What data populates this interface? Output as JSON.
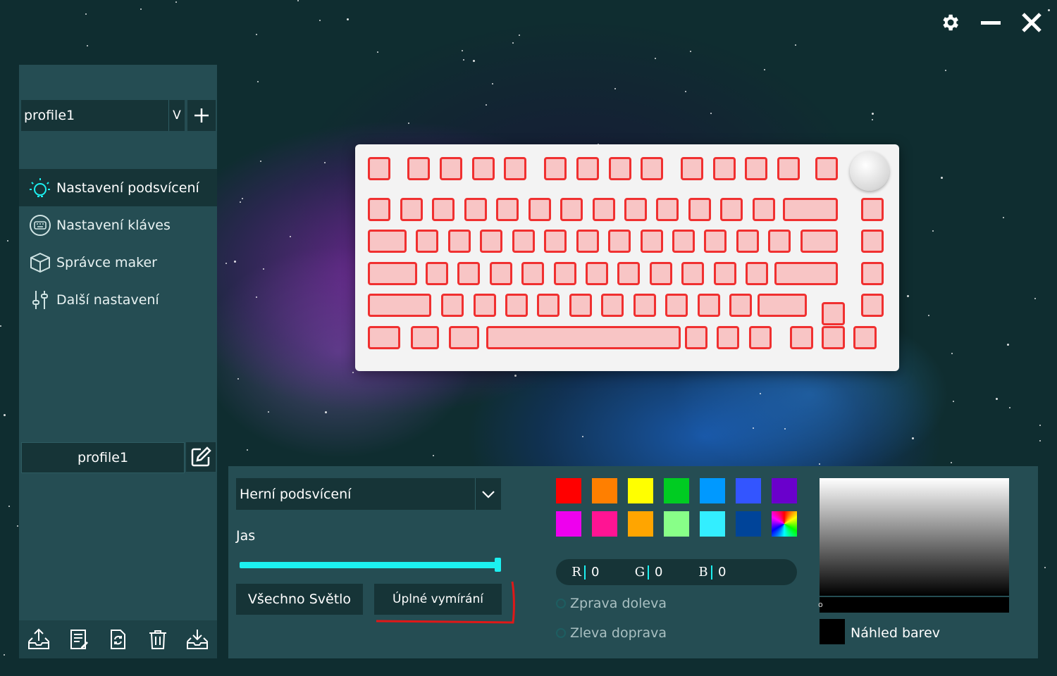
{
  "window": {
    "controls": [
      "gear-icon",
      "minimize-icon",
      "close-icon"
    ]
  },
  "sidebar": {
    "profile_select": {
      "value": "profile1",
      "dropdown_label": "V"
    },
    "nav": [
      {
        "label": "Nastavení podsvícení",
        "icon": "lightbulb-icon",
        "active": true
      },
      {
        "label": "Nastavení kláves",
        "icon": "keyboard-icon",
        "active": false
      },
      {
        "label": "Správce maker",
        "icon": "cube-icon",
        "active": false
      },
      {
        "label": "Další nastavení",
        "icon": "sliders-icon",
        "active": false
      }
    ],
    "profile_name": "profile1",
    "tools": [
      "export-icon",
      "notes-icon",
      "refresh-icon",
      "trash-icon",
      "import-icon"
    ]
  },
  "lighting": {
    "mode": "Herní podsvícení",
    "brightness_label": "Jas",
    "brightness": 1.0,
    "buttons": {
      "all_light": "Všechno Světlo",
      "full_fade": "Úplné vymírání"
    },
    "swatches": [
      "#ff0000",
      "#ff7f00",
      "#ffff00",
      "#00cc22",
      "#0099ff",
      "#3355ff",
      "#6a00cc",
      "#ee00ee",
      "#ff1493",
      "#ffa500",
      "#88ff88",
      "#33eeff",
      "#004499",
      "rainbow"
    ],
    "rgb": {
      "r_label": "R",
      "r": "0",
      "g_label": "G",
      "g": "0",
      "b_label": "B",
      "b": "0"
    },
    "direction": {
      "right_to_left": "Zprava doleva",
      "left_to_right": "Zleva doprava"
    },
    "preview_label": "Náhled barev",
    "hue_marker": "o",
    "preview_color": "#000000"
  }
}
